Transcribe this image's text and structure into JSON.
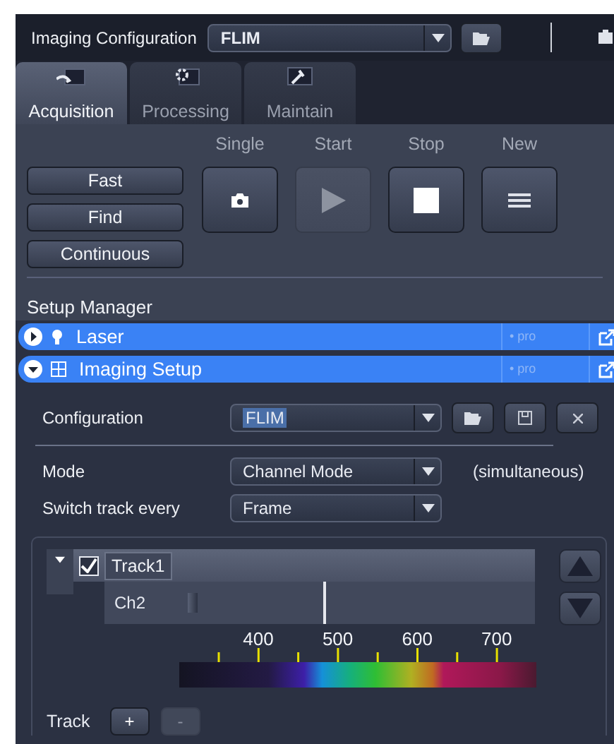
{
  "header": {
    "title": "Imaging Configuration",
    "configuration": "FLIM"
  },
  "tabs": [
    {
      "label": "Acquisition",
      "selected": true
    },
    {
      "label": "Processing",
      "selected": false
    },
    {
      "label": "Maintain",
      "selected": false
    }
  ],
  "acquisition": {
    "mode_buttons": [
      "Fast",
      "Find",
      "Continuous"
    ],
    "actions": [
      {
        "label": "Single",
        "kind": "snap",
        "disabled": false
      },
      {
        "label": "Start",
        "kind": "start",
        "disabled": true
      },
      {
        "label": "Stop",
        "kind": "stop",
        "disabled": false
      },
      {
        "label": "New",
        "kind": "new",
        "disabled": false
      }
    ]
  },
  "setup_manager": {
    "title": "Setup Manager",
    "sections": [
      {
        "label": "Laser",
        "kind": "laser",
        "expanded": false,
        "badge": "• pro"
      },
      {
        "label": "Imaging Setup",
        "kind": "imaging",
        "expanded": true,
        "badge": "• pro"
      }
    ]
  },
  "imaging_setup": {
    "configuration_label": "Configuration",
    "configuration": "FLIM",
    "mode_label": "Mode",
    "mode": "Channel Mode",
    "mode_note": "(simultaneous)",
    "switch_label": "Switch track every",
    "switch": "Frame",
    "tracks": [
      {
        "name": "Track1",
        "checked": true,
        "expanded": true,
        "channels": [
          "Ch2"
        ]
      }
    ],
    "scale": [
      "400",
      "500",
      "600",
      "700"
    ],
    "track_label": "Track",
    "track_add": "+",
    "track_remove": "-"
  }
}
